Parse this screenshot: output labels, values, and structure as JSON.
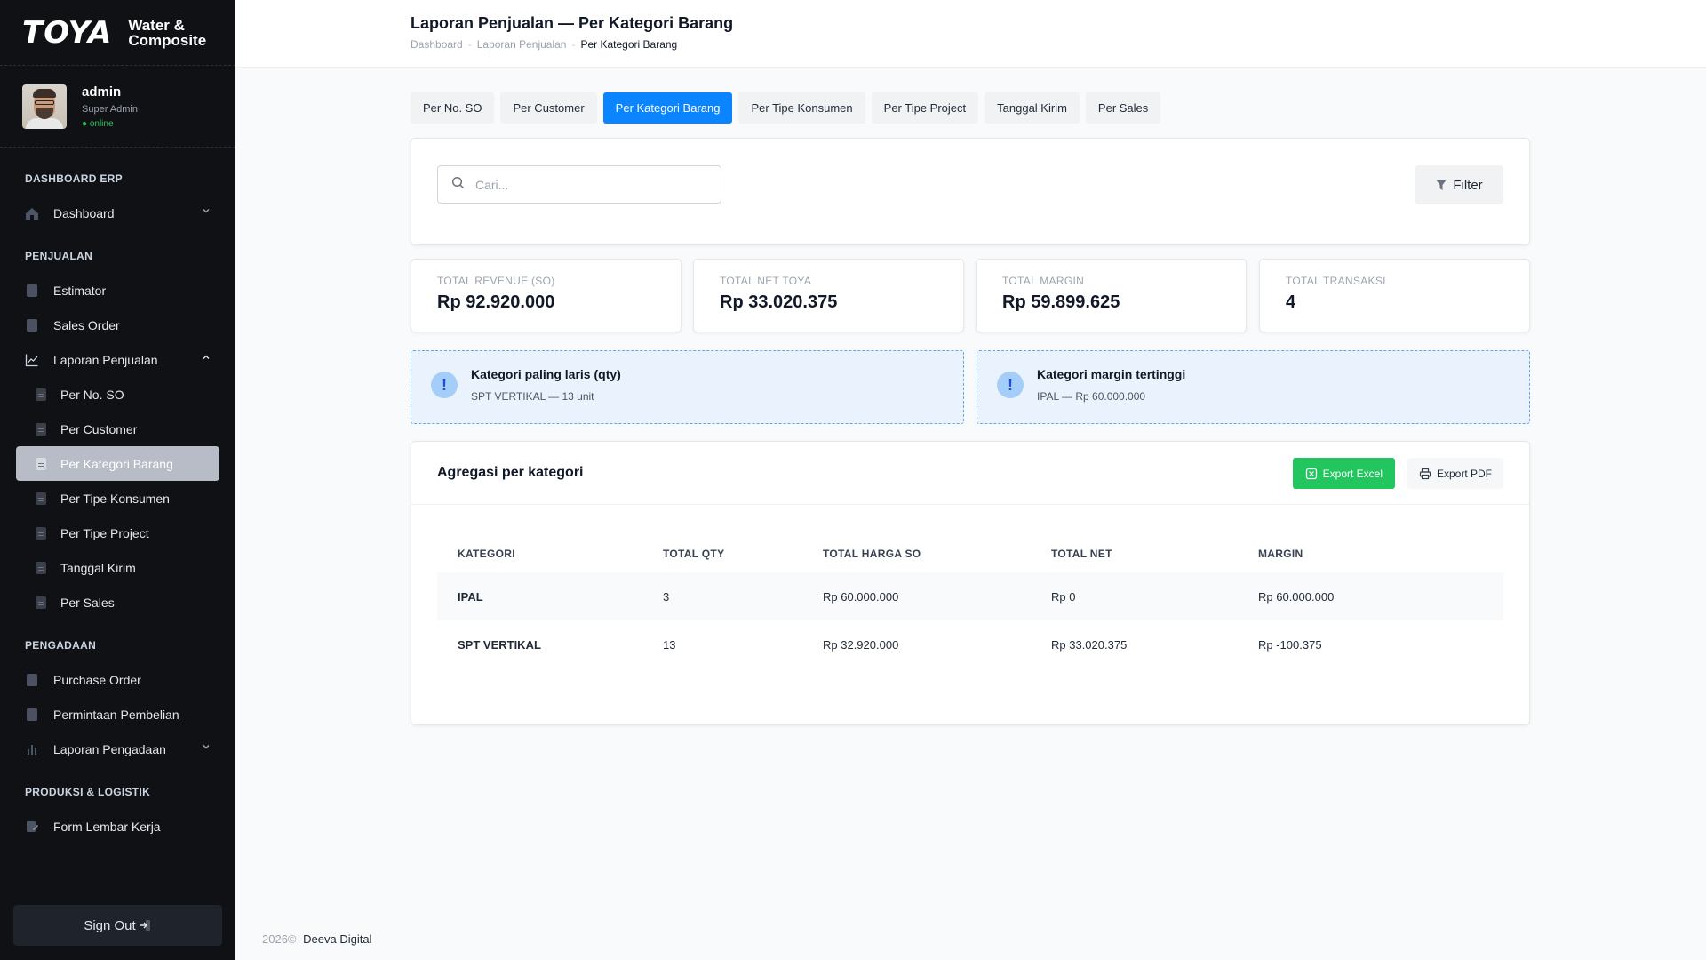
{
  "brand": {
    "logo": "TOYA",
    "sub_line1": "Water &",
    "sub_line2": "Composite"
  },
  "user": {
    "name": "admin",
    "role": "Super Admin",
    "status": "● online"
  },
  "nav": {
    "sections": {
      "dashboard": "DASHBOARD ERP",
      "penjualan": "PENJUALAN",
      "pengadaan": "PENGADAAN",
      "produksi": "PRODUKSI & LOGISTIK"
    },
    "items": {
      "dashboard": "Dashboard",
      "estimator": "Estimator",
      "sales_order": "Sales Order",
      "laporan_penjualan": "Laporan Penjualan",
      "per_no_so": "Per No. SO",
      "per_customer": "Per Customer",
      "per_kategori": "Per Kategori Barang",
      "per_tipe_konsumen": "Per Tipe Konsumen",
      "per_tipe_project": "Per Tipe Project",
      "tanggal_kirim": "Tanggal Kirim",
      "per_sales": "Per Sales",
      "purchase_order": "Purchase Order",
      "permintaan_pembelian": "Permintaan Pembelian",
      "laporan_pengadaan": "Laporan Pengadaan",
      "form_lembar_kerja": "Form Lembar Kerja"
    },
    "sign_out": "Sign Out"
  },
  "header": {
    "title": "Laporan Penjualan — Per Kategori Barang",
    "breadcrumb": [
      "Dashboard",
      "Laporan Penjualan",
      "Per Kategori Barang"
    ]
  },
  "tabs": [
    "Per No. SO",
    "Per Customer",
    "Per Kategori Barang",
    "Per Tipe Konsumen",
    "Per Tipe Project",
    "Tanggal Kirim",
    "Per Sales"
  ],
  "search": {
    "placeholder": "Cari...",
    "value": ""
  },
  "filter_label": "Filter",
  "stats": [
    {
      "label": "TOTAL REVENUE (SO)",
      "value": "Rp 92.920.000"
    },
    {
      "label": "TOTAL NET TOYA",
      "value": "Rp 33.020.375"
    },
    {
      "label": "TOTAL MARGIN",
      "value": "Rp 59.899.625"
    },
    {
      "label": "TOTAL TRANSAKSI",
      "value": "4"
    }
  ],
  "info": [
    {
      "title": "Kategori paling laris (qty)",
      "desc": "SPT VERTIKAL — 13 unit"
    },
    {
      "title": "Kategori margin tertinggi",
      "desc": "IPAL — Rp 60.000.000"
    }
  ],
  "table": {
    "title": "Agregasi per kategori",
    "export_excel": "Export Excel",
    "export_pdf": "Export PDF",
    "headers": [
      "KATEGORI",
      "TOTAL QTY",
      "TOTAL HARGA SO",
      "TOTAL NET",
      "MARGIN"
    ],
    "rows": [
      [
        "IPAL",
        "3",
        "Rp 60.000.000",
        "Rp 0",
        "Rp 60.000.000"
      ],
      [
        "SPT VERTIKAL",
        "13",
        "Rp 32.920.000",
        "Rp 33.020.375",
        "Rp -100.375"
      ]
    ]
  },
  "footer": {
    "year": "2026©",
    "company": "Deeva Digital"
  },
  "colors": {
    "accent": "#0a84ff",
    "excel": "#22c55e",
    "sidebar_bg": "#0f1115",
    "online": "#22c55e"
  }
}
